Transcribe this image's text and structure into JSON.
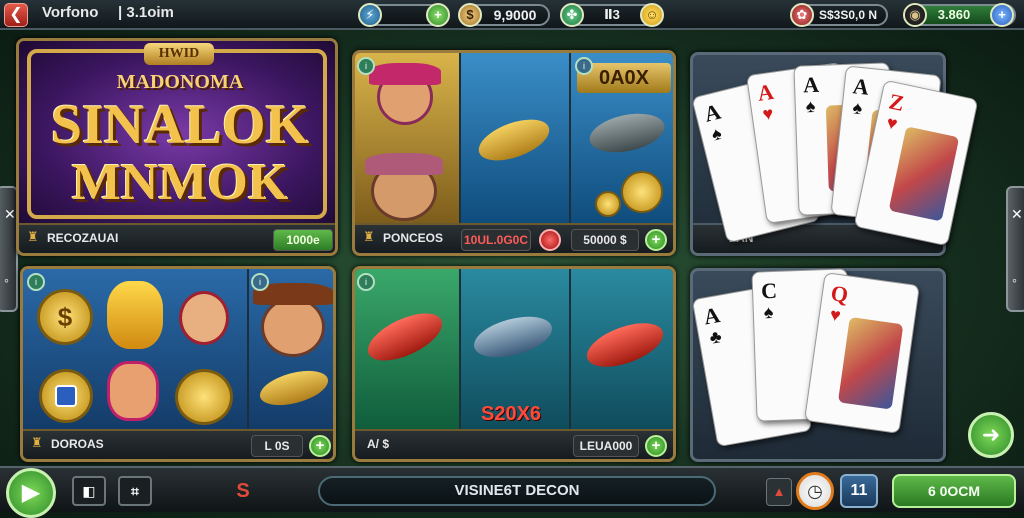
{
  "topbar": {
    "back_icon": "back-arrow-icon",
    "title": "Vorfono",
    "subtitle": "3.1oim",
    "resource1": "",
    "resource2": "9,9000",
    "resource3": "Ⅱ3",
    "stat_right": "S$3S0,0 N",
    "green_counter": "3.860"
  },
  "panels": {
    "slot_left_top": {
      "logo_top": "HWID",
      "logo_sub": "MADONOMA",
      "logo_line1": "SINALOK",
      "logo_line2": "MNMOK",
      "footer_label": "RECOZAUAI",
      "footer_value": "1000e"
    },
    "slot_mid_top": {
      "multiplier": "0A0X",
      "footer_label": "PONCEOS",
      "footer_value": "10UL.0G0C",
      "footer_value2": "50000 $"
    },
    "slot_left_bottom": {
      "footer_label": "DOROAS",
      "footer_value": "L 0S"
    },
    "slot_mid_bottom": {
      "multiplier": "S20X6",
      "footer_label": "A/ $",
      "footer_value": "LEUA000"
    },
    "cards_top": {
      "footer_label": "PAN"
    }
  },
  "cards_top": [
    {
      "rank": "A",
      "suit": "♠",
      "color": "blk"
    },
    {
      "rank": "A",
      "suit": "♥",
      "color": "red"
    },
    {
      "rank": "A",
      "suit": "♠",
      "color": "blk"
    },
    {
      "rank": "A",
      "suit": "♠",
      "color": "blk"
    },
    {
      "rank": "Z",
      "suit": "♥",
      "color": "red"
    }
  ],
  "cards_bottom": [
    {
      "rank": "A",
      "suit": "♣",
      "color": "blk"
    },
    {
      "rank": "C",
      "suit": "♠",
      "color": "blk"
    },
    {
      "rank": "Q",
      "suit": "♥",
      "color": "red"
    }
  ],
  "bottombar": {
    "center_label": "VISINE6T DECON",
    "badge": "11",
    "right_button": "6 0OCM",
    "dollar": "S"
  },
  "colors": {
    "gold": "#c99a3a",
    "green": "#3fa33a",
    "red": "#d21a1a",
    "purple": "#5a2a8a"
  }
}
